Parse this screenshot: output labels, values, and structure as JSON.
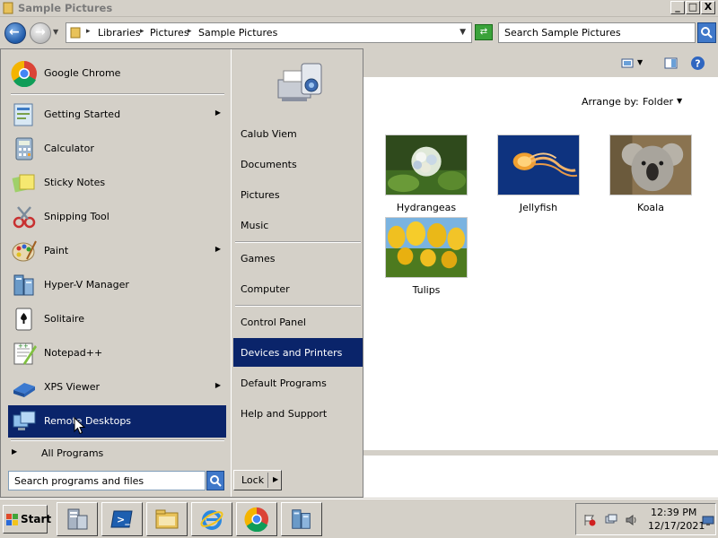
{
  "window": {
    "title": "Sample Pictures",
    "min_label": "_",
    "max_label": "□",
    "close_label": "X"
  },
  "address": {
    "crumbs": [
      "Libraries",
      "Pictures",
      "Sample Pictures"
    ],
    "search_placeholder": "Search Sample Pictures"
  },
  "content": {
    "arrange_label": "Arrange by:",
    "arrange_value": "Folder",
    "pictures": [
      {
        "label": "Hydrangeas"
      },
      {
        "label": "Jellyfish"
      },
      {
        "label": "Koala"
      },
      {
        "label": "Tulips"
      }
    ]
  },
  "start_menu": {
    "left_items": [
      {
        "label": "Google Chrome",
        "icon": "chrome-icon"
      },
      {
        "label": "Getting Started",
        "icon": "getting-started-icon",
        "submenu": true
      },
      {
        "label": "Calculator",
        "icon": "calculator-icon"
      },
      {
        "label": "Sticky Notes",
        "icon": "sticky-notes-icon"
      },
      {
        "label": "Snipping Tool",
        "icon": "snipping-tool-icon"
      },
      {
        "label": "Paint",
        "icon": "paint-icon",
        "submenu": true
      },
      {
        "label": "Hyper-V Manager",
        "icon": "hyper-v-icon"
      },
      {
        "label": "Solitaire",
        "icon": "solitaire-icon"
      },
      {
        "label": "Notepad++",
        "icon": "notepad-plus-plus-icon"
      },
      {
        "label": "XPS Viewer",
        "icon": "xps-viewer-icon",
        "submenu": true
      },
      {
        "label": "Remote Desktops",
        "icon": "remote-desktops-icon",
        "selected": true
      }
    ],
    "all_programs": "All Programs",
    "search_placeholder": "Search programs and files",
    "right_items": [
      {
        "label": "Calub Viem"
      },
      {
        "label": "Documents"
      },
      {
        "label": "Pictures"
      },
      {
        "label": "Music"
      },
      {
        "label": "Games"
      },
      {
        "label": "Computer"
      },
      {
        "label": "Control Panel"
      },
      {
        "label": "Devices and Printers",
        "selected": true
      },
      {
        "label": "Default Programs"
      },
      {
        "label": "Help and Support"
      }
    ],
    "lock_label": "Lock"
  },
  "taskbar": {
    "start_label": "Start",
    "apps": [
      "server-manager-icon",
      "powershell-icon",
      "explorer-icon",
      "internet-explorer-icon",
      "chrome-icon",
      "hyper-v-icon"
    ],
    "time": "12:39 PM",
    "date": "12/17/2021"
  },
  "colors": {
    "selection": "#0a246a",
    "chrome_face": "#d4d0c8"
  }
}
